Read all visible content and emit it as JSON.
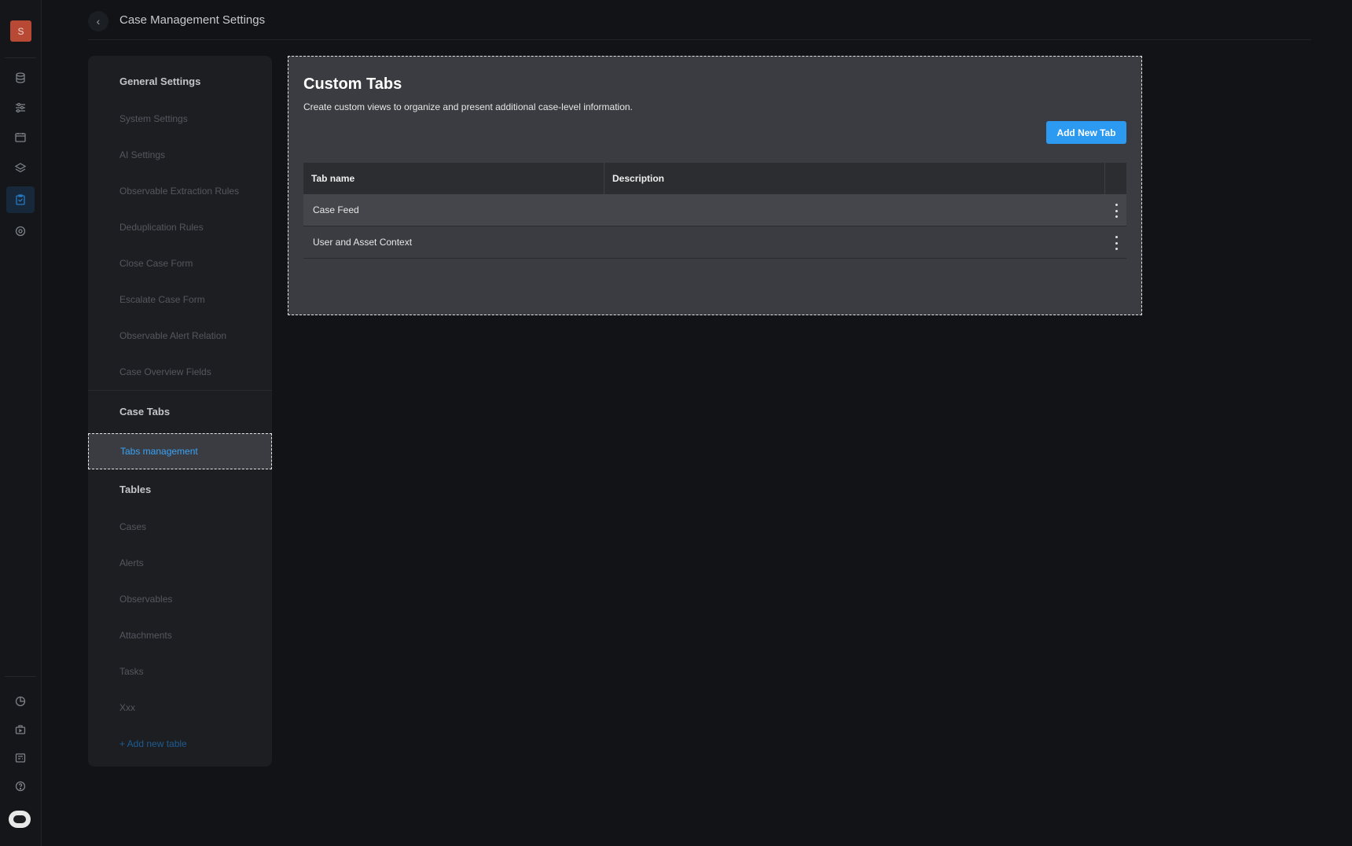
{
  "app": {
    "avatar_initial": "S",
    "page_title": "Case Management Settings"
  },
  "rail": {
    "icons": [
      "database-icon",
      "sliders-icon",
      "calendar-icon",
      "layers-icon",
      "cases-icon",
      "target-icon"
    ],
    "active": "cases-icon",
    "bottom_icons": [
      "clock-icon",
      "briefcase-icon",
      "reports-icon",
      "help-icon",
      "assistant-bot-icon"
    ]
  },
  "nav": {
    "general_title": "General Settings",
    "general_items": [
      "System Settings",
      "AI Settings",
      "Observable Extraction Rules",
      "Deduplication Rules",
      "Close Case Form",
      "Escalate Case Form",
      "Observable Alert Relation",
      "Case Overview Fields"
    ],
    "case_tabs_title": "Case Tabs",
    "case_tabs_active": "Tabs management",
    "tables_title": "Tables",
    "table_items": [
      "Cases",
      "Alerts",
      "Observables",
      "Attachments",
      "Tasks",
      "Xxx"
    ],
    "add_table": "+ Add new table"
  },
  "panel": {
    "title": "Custom Tabs",
    "description": "Create custom views to organize and present additional case-level information.",
    "add_button": "Add New Tab",
    "columns": [
      "Tab name",
      "Description"
    ],
    "rows": [
      {
        "name": "Case Feed",
        "description": ""
      },
      {
        "name": "User and Asset Context",
        "description": ""
      }
    ]
  },
  "colors": {
    "accent": "#2b9af0",
    "active_link": "#3aa3f5",
    "avatar": "#b84a35"
  }
}
